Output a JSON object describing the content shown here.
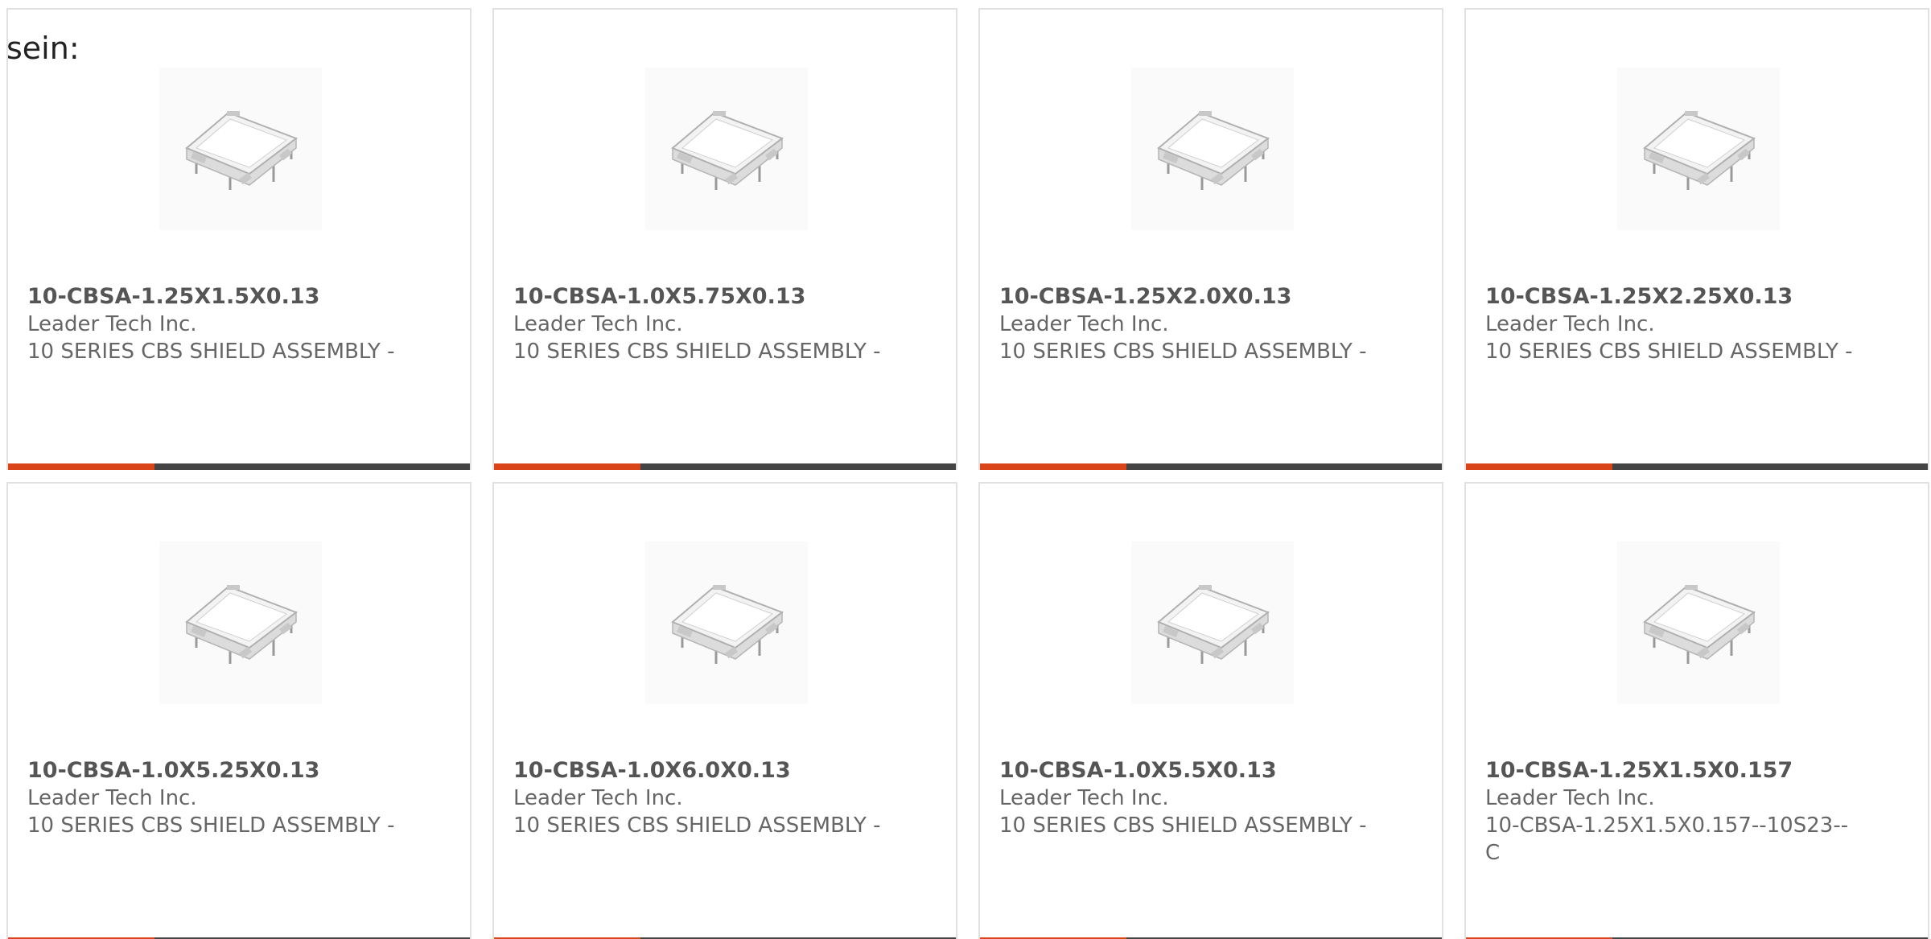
{
  "intro_text": "sein:",
  "colors": {
    "accent": "#d94418",
    "bar_dark": "#444444",
    "card_border": "#e1e1e1",
    "text": "#666666"
  },
  "products": [
    {
      "part_number": "10-CBSA-1.25X1.5X0.13",
      "manufacturer": "Leader Tech Inc.",
      "description": "10 SERIES CBS SHIELD ASSEMBLY -",
      "image": "shield-can-icon"
    },
    {
      "part_number": "10-CBSA-1.0X5.75X0.13",
      "manufacturer": "Leader Tech Inc.",
      "description": "10 SERIES CBS SHIELD ASSEMBLY -",
      "image": "shield-can-icon"
    },
    {
      "part_number": "10-CBSA-1.25X2.0X0.13",
      "manufacturer": "Leader Tech Inc.",
      "description": "10 SERIES CBS SHIELD ASSEMBLY -",
      "image": "shield-can-icon"
    },
    {
      "part_number": "10-CBSA-1.25X2.25X0.13",
      "manufacturer": "Leader Tech Inc.",
      "description": "10 SERIES CBS SHIELD ASSEMBLY -",
      "image": "shield-can-icon"
    },
    {
      "part_number": "10-CBSA-1.0X5.25X0.13",
      "manufacturer": "Leader Tech Inc.",
      "description": "10 SERIES CBS SHIELD ASSEMBLY -",
      "image": "shield-can-icon"
    },
    {
      "part_number": "10-CBSA-1.0X6.0X0.13",
      "manufacturer": "Leader Tech Inc.",
      "description": "10 SERIES CBS SHIELD ASSEMBLY -",
      "image": "shield-can-icon"
    },
    {
      "part_number": "10-CBSA-1.0X5.5X0.13",
      "manufacturer": "Leader Tech Inc.",
      "description": "10 SERIES CBS SHIELD ASSEMBLY -",
      "image": "shield-can-icon"
    },
    {
      "part_number": "10-CBSA-1.25X1.5X0.157",
      "manufacturer": "Leader Tech Inc.",
      "description": "10-CBSA-1.25X1.5X0.157--10S23--C",
      "image": "shield-can-icon"
    }
  ]
}
